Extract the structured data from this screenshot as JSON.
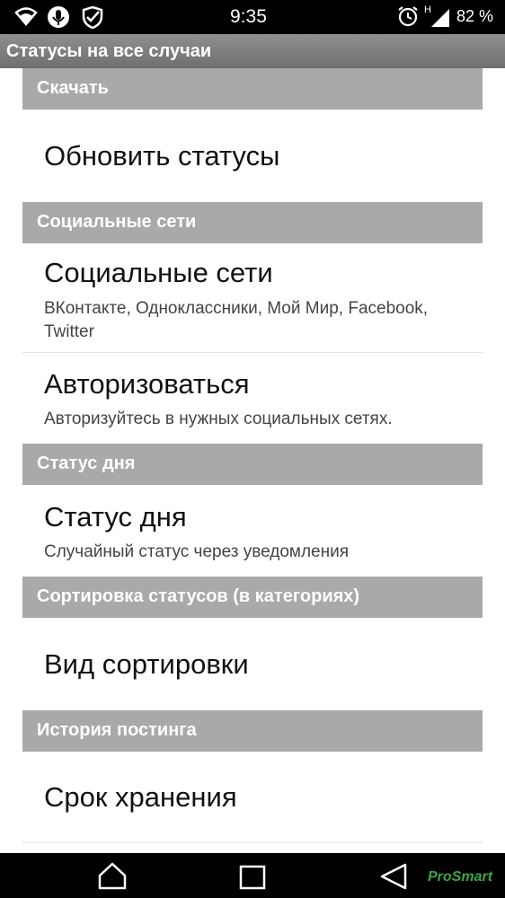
{
  "status_bar": {
    "time": "9:35",
    "battery_percent": "82 %",
    "network_type": "H",
    "icons": [
      "wifi-icon",
      "microphone-icon",
      "shield-check-icon",
      "alarm-icon",
      "signal-icon",
      "battery-icon"
    ]
  },
  "app_bar": {
    "title": "Статусы на все случаи"
  },
  "preferences": {
    "download": {
      "header": "Скачать",
      "update": {
        "title": "Обновить статусы"
      }
    },
    "social": {
      "header": "Социальные сети",
      "networks": {
        "title": "Социальные сети",
        "summary": "ВКонтакте, Одноклассники, Мой Мир, Facebook, Twitter"
      },
      "authorize": {
        "title": "Авторизоваться",
        "summary": "Авторизуйтесь в нужных социальных сетях."
      }
    },
    "status_of_day": {
      "header": "Статус дня",
      "item": {
        "title": "Статус дня",
        "summary": "Случайный статус через уведомления"
      }
    },
    "sorting": {
      "header": "Сортировка статусов (в категориях)",
      "view": {
        "title": "Вид сортировки"
      }
    },
    "history": {
      "header": "История постинга",
      "retention": {
        "title": "Срок хранения"
      }
    }
  },
  "navigation_bar": {
    "buttons": [
      "home-icon",
      "recents-icon",
      "back-icon"
    ],
    "watermark": "ProSmart"
  },
  "colors": {
    "section_header_bg": "#a9a9a9",
    "app_bar_bg": "#7f7f7f",
    "watermark_green": "#3aa644"
  }
}
